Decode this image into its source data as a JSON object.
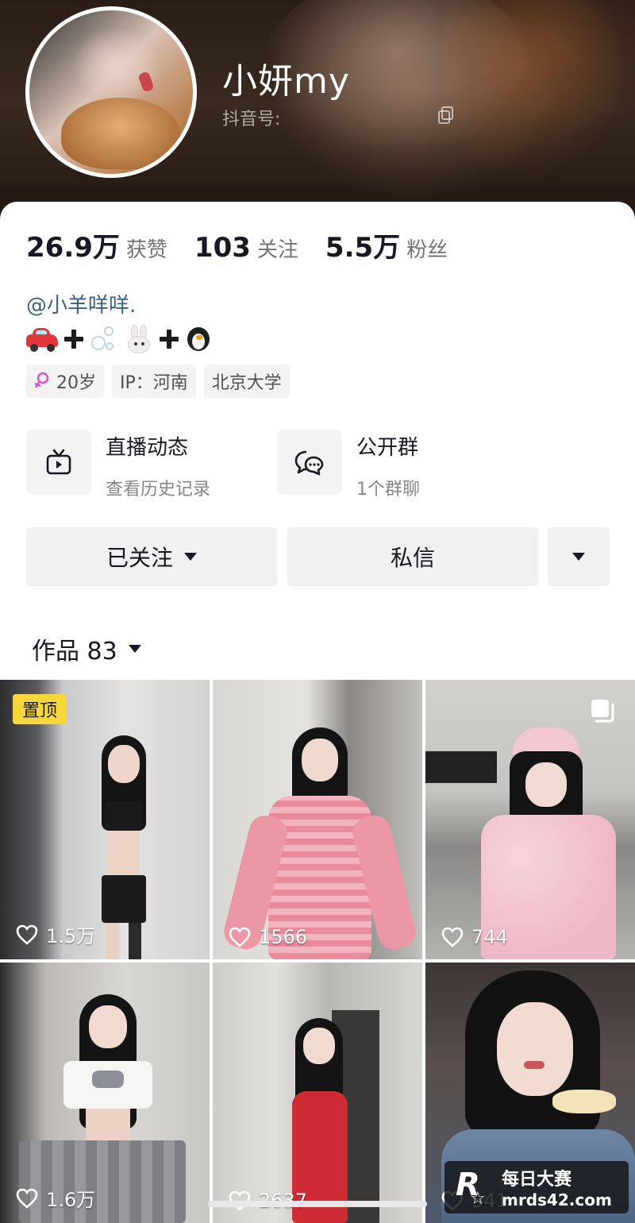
{
  "profile": {
    "name": "小妍my",
    "douyin_id_label": "抖音号:",
    "stats": [
      {
        "value": "26.9万",
        "label": "获赞"
      },
      {
        "value": "103",
        "label": "关注"
      },
      {
        "value": "5.5万",
        "label": "粉丝"
      }
    ],
    "mention": "@小羊咩咩.",
    "bio_icons": [
      "car-icon",
      "plus-icon",
      "bubbles-icon",
      "bunny-icon",
      "plus-icon",
      "penguin-icon"
    ],
    "tags": [
      {
        "icon": "female-icon",
        "label": "20岁"
      },
      {
        "label": "IP：河南"
      },
      {
        "label": "北京大学"
      }
    ]
  },
  "features": [
    {
      "icon": "live-tv-icon",
      "title": "直播动态",
      "subtitle": "查看历史记录"
    },
    {
      "icon": "group-chat-icon",
      "title": "公开群",
      "subtitle": "1个群聊"
    }
  ],
  "actions": {
    "follow_label": "已关注",
    "message_label": "私信"
  },
  "works": {
    "label": "作品 83",
    "pinned_label": "置顶",
    "items": [
      {
        "likes": "1.5万",
        "pinned": true
      },
      {
        "likes": "1566"
      },
      {
        "likes": "744",
        "multi": true
      },
      {
        "likes": "1.6万"
      },
      {
        "likes": "2637"
      },
      {
        "likes": "541"
      }
    ]
  },
  "watermark": {
    "line1": "每日大赛",
    "line2": "mrds42.com"
  },
  "colors": {
    "accent_link": "#3a5f86",
    "pinned_badge": "#f7d73b",
    "button_bg": "#f1f1f2"
  }
}
